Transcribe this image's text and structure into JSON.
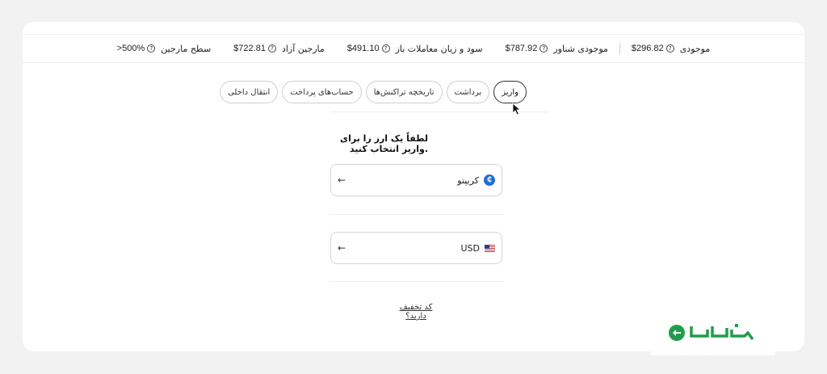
{
  "stats": [
    {
      "label": "موجودی",
      "value": "$296.82"
    },
    {
      "label": "موجودی شناور",
      "value": "$787.92"
    },
    {
      "label": "سود و زیان معاملات باز",
      "value": "$491.10"
    },
    {
      "label": "مارجین آزاد",
      "value": "$722.81"
    },
    {
      "label": "سطح مارجین",
      "value": ">500%"
    }
  ],
  "tabs": [
    {
      "label": "واریز",
      "active": true
    },
    {
      "label": "برداشت"
    },
    {
      "label": "تاریخچه تراکنش‌ها"
    },
    {
      "label": "حساب‌های پرداخت"
    },
    {
      "label": "انتقال داخلی"
    }
  ],
  "prompt": "لطفاً یک ارز را برای واریز انتخاب کنید.",
  "options": [
    {
      "name": "کریپتو",
      "icon": "crypto-coin-icon"
    },
    {
      "name": "USD",
      "icon": "us-flag-icon"
    }
  ],
  "discount_link": "کد تخفیف دارید؟",
  "colors": {
    "crypto": "#1a6fe0",
    "logo": "#1f9e4a"
  }
}
